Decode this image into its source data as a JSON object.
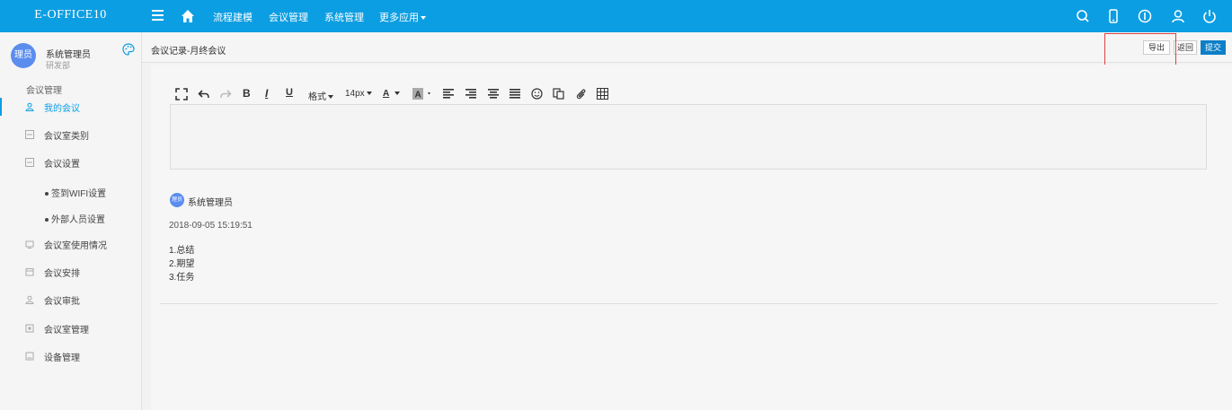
{
  "app": {
    "brand": "E-OFFICE10"
  },
  "topnav": {
    "items": [
      "流程建模",
      "会议管理",
      "系统管理",
      "更多应用"
    ],
    "icons": [
      "menu-icon",
      "home-icon",
      "search-icon",
      "mobile-icon",
      "info-icon",
      "user-icon",
      "power-icon"
    ]
  },
  "user": {
    "avatar_text": "理员",
    "name": "系统管理员",
    "dept": "研发部"
  },
  "sidebar": {
    "section": "会议管理",
    "items": [
      {
        "label": "我的会议",
        "active": true
      },
      {
        "label": "会议室类别"
      },
      {
        "label": "会议设置"
      },
      {
        "label": "签到WIFI设置",
        "sub": true
      },
      {
        "label": "外部人员设置",
        "sub": true
      },
      {
        "label": "会议室使用情况"
      },
      {
        "label": "会议安排"
      },
      {
        "label": "会议审批"
      },
      {
        "label": "会议室管理"
      },
      {
        "label": "设备管理"
      }
    ]
  },
  "header": {
    "title": "会议记录-月终会议",
    "buttons": {
      "export": "导出",
      "back": "返回",
      "submit": "提交"
    }
  },
  "toolbar": {
    "format_label": "格式",
    "size_label": "14px",
    "tooltip": "斜体"
  },
  "comment": {
    "avatar_text": "理员",
    "author": "系统管理员",
    "time": "2018-09-05 15:19:51",
    "lines": [
      "1.总结",
      "2.期望",
      "3.任务"
    ]
  },
  "colors": {
    "primary": "#0c9ee2",
    "button": "#0c7fc7",
    "highlight": "#e04040"
  }
}
